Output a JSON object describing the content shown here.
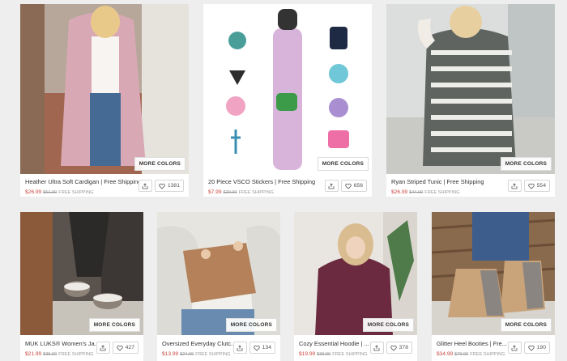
{
  "cards": [
    {
      "title": "Heather Ultra Soft Cardigan | Free Shipping",
      "price": "$26.99",
      "old_price": "$51.99",
      "shipping": "FREE SHIPPING",
      "more": "MORE COLORS",
      "likes": "1381"
    },
    {
      "title": "20 Piece VSCO Stickers | Free Shipping",
      "price": "$7.99",
      "old_price": "$29.99",
      "shipping": "FREE SHIPPING",
      "more": "MORE COLORS",
      "likes": "656"
    },
    {
      "title": "Ryan Striped Tunic | Free Shipping",
      "price": "$26.99",
      "old_price": "$44.99",
      "shipping": "FREE SHIPPING",
      "more": "MORE COLORS",
      "likes": "554"
    },
    {
      "title": "MUK LUKS® Women's Ja...",
      "price": "$21.99",
      "old_price": "$35.00",
      "shipping": "FREE SHIPPING",
      "more": "MORE COLORS",
      "likes": "427"
    },
    {
      "title": "Oversized Everyday Clutc...",
      "price": "$13.99",
      "old_price": "$24.99",
      "shipping": "FREE SHIPPING",
      "more": "MORE COLORS",
      "likes": "134"
    },
    {
      "title": "Cozy Essential Hoodie | ...",
      "price": "$19.99",
      "old_price": "$39.99",
      "shipping": "FREE SHIPPING",
      "more": "MORE COLORS",
      "likes": "378"
    },
    {
      "title": "Glitter Heel Booties | Fre...",
      "price": "$34.99",
      "old_price": "$79.99",
      "shipping": "FREE SHIPPING",
      "more": "MORE COLORS",
      "likes": "190"
    }
  ],
  "colors": {
    "price": "#c8463e",
    "page_bg": "#eeeeee"
  },
  "icons": {
    "share": "share-icon",
    "like": "heart-icon"
  }
}
